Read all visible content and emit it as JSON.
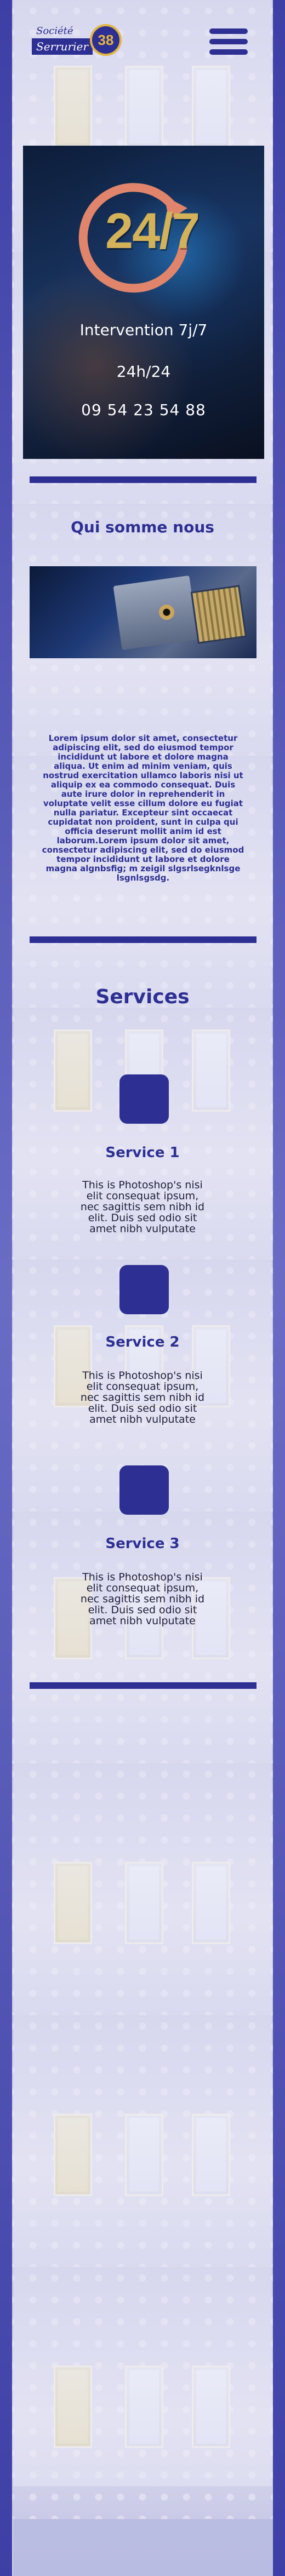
{
  "header": {
    "logo_line1": "Société",
    "logo_line2": "Serrurier",
    "logo_number": "38"
  },
  "hero": {
    "badge": "24/7",
    "title": "Intervention 7j/7",
    "subtitle": "24h/24",
    "phone": "09 54 23 54 88"
  },
  "about": {
    "title": "Qui somme nous",
    "text": "Lorem ipsum dolor sit amet, consectetur adipiscing elit, sed do eiusmod tempor incididunt ut labore et dolore magna aliqua. Ut enim ad minim veniam, quis nostrud exercitation ullamco laboris nisi ut aliquip ex ea commodo consequat. Duis aute irure dolor in reprehenderit in voluptate velit esse cillum dolore eu fugiat nulla pariatur. Excepteur sint occaecat cupidatat non proident, sunt in culpa qui officia deserunt mollit anim id est laborum.Lorem ipsum dolor sit amet, consectetur adipiscing elit, sed do eiusmod tempor incididunt ut labore et dolore magna algnbsfig; m zeigil slgsrlsegknlsge lsgnlsgsdg."
  },
  "services": {
    "title": "Services",
    "items": [
      {
        "title": "Service 1",
        "desc": "This is Photoshop's nisi elit consequat ipsum, nec sagittis sem nibh id elit. Duis sed odio sit amet nibh vulputate"
      },
      {
        "title": "Service 2",
        "desc": "This is Photoshop's nisi elit consequat ipsum, nec sagittis sem nibh id elit. Duis sed odio sit amet nibh vulputate"
      },
      {
        "title": "Service 3",
        "desc": "This is Photoshop's nisi elit consequat ipsum, nec sagittis sem nibh id elit. Duis sed odio sit amet nibh vulputate"
      }
    ]
  },
  "colors": {
    "brand_blue": "#2d2f93",
    "gold": "#e2b541"
  },
  "icons": [
    "menu-icon",
    "service-icon"
  ]
}
